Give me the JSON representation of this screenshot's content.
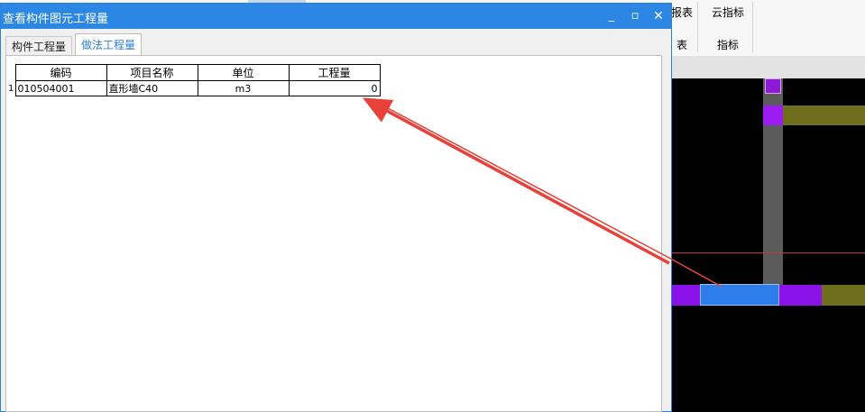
{
  "background_app": {
    "ribbon": {
      "buttons": [
        {
          "label": "报表"
        },
        {
          "label": "云指标"
        }
      ],
      "groups": [
        {
          "label": "表"
        },
        {
          "label": "指标"
        }
      ]
    }
  },
  "dialog": {
    "title": "查看构件图元工程量",
    "controls": {
      "minimize": "_",
      "maximize": "▫",
      "close": "✕"
    },
    "tabs": [
      {
        "label": "构件工程量",
        "active": false
      },
      {
        "label": "做法工程量",
        "active": true
      }
    ],
    "table": {
      "headers": [
        "编码",
        "项目名称",
        "单位",
        "工程量"
      ],
      "rows": [
        {
          "index": "1",
          "code": "010504001",
          "name": "直形墙C40",
          "unit": "m3",
          "quantity": "0"
        }
      ]
    }
  },
  "colors": {
    "title_bar": "#2b87e3",
    "active_tab_text": "#2b7de0",
    "annotation_arrow": "#e8413a",
    "selected_element": "#2d7dea"
  }
}
